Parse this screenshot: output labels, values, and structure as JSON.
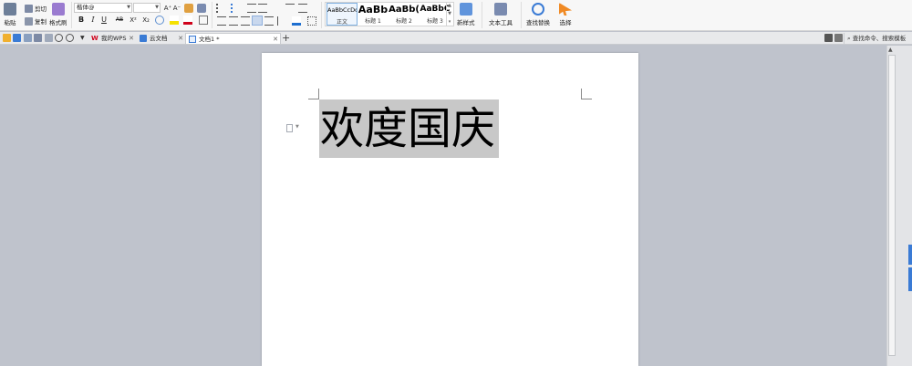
{
  "ribbon": {
    "clipboard": {
      "paste_label": "粘贴",
      "cut_label": "剪切",
      "copy_label": "复制",
      "format_painter_label": "格式刷"
    },
    "font": {
      "font_name": "楷体@",
      "font_size": "",
      "grow_label": "A⁺",
      "shrink_label": "A⁻",
      "bold": "B",
      "italic": "I",
      "underline": "U",
      "strike": "AB",
      "superscript": "X²",
      "subscript": "X₂"
    },
    "styles": [
      {
        "preview": "AaBbCcDd",
        "name": "正文",
        "selected": true
      },
      {
        "preview": "AaBb",
        "name": "标题 1",
        "selected": false
      },
      {
        "preview": "AaBb(",
        "name": "标题 2",
        "selected": false
      },
      {
        "preview": "AaBbC",
        "name": "标题 3",
        "selected": false
      }
    ],
    "new_style_label": "新样式",
    "text_tools_label": "文本工具",
    "find_replace_label": "查找替换",
    "select_label": "选择"
  },
  "tabbar": {
    "tabs": [
      {
        "label": "我的WPS",
        "icon": "wps-logo-icon",
        "active": false
      },
      {
        "label": "云文档",
        "icon": "cloud-doc-icon",
        "active": false
      },
      {
        "label": "文档1 *",
        "icon": "document-icon",
        "active": true
      }
    ],
    "search_command": "查找命令、搜索模板"
  },
  "document": {
    "text": "欢度国庆"
  },
  "colors": {
    "accent": "#3a7bd5",
    "selection": "#c8c8c8",
    "wps_red": "#d0021b"
  }
}
